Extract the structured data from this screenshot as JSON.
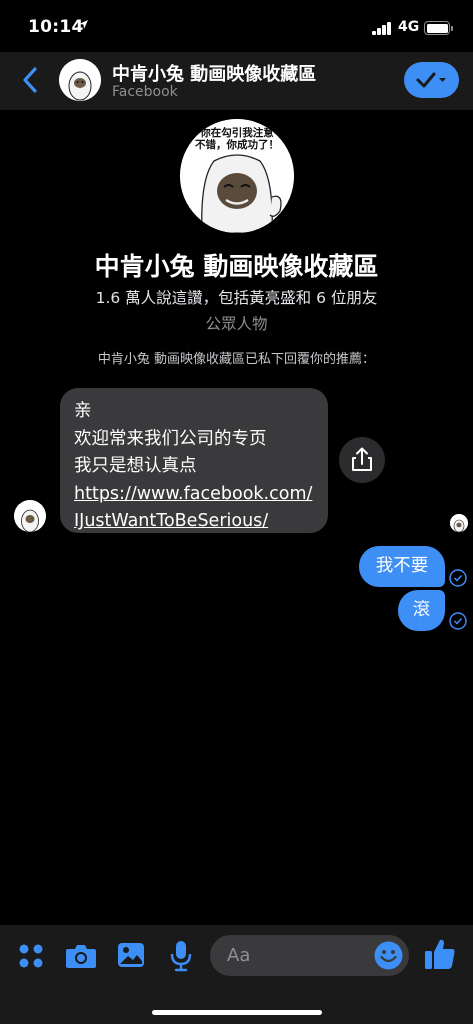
{
  "status_bar": {
    "time": "10:14",
    "network": "4G"
  },
  "header": {
    "title": "中肯小兔 動画映像收藏區",
    "subtitle": "Facebook"
  },
  "profile": {
    "avatar_caption_line1": "你在勾引我注意",
    "avatar_caption_line2": "不错，你成功了！",
    "name": "中肯小兔 動画映像收藏區",
    "likes": "1.6 萬人說這讚，包括黃亮盛和 6 位朋友",
    "category": "公眾人物",
    "reply_note": "中肯小兔 動画映像收藏區已私下回覆你的推薦："
  },
  "messages": {
    "incoming": {
      "line1": "亲",
      "line2": "欢迎常来我们公司的专页",
      "line3": "我只是想认真点",
      "link_line1": "https://www.facebook.com/",
      "link_line2": "IJustWantToBeSerious/"
    },
    "outgoing": [
      "我不要",
      "滾"
    ]
  },
  "composer": {
    "placeholder": "Aa"
  },
  "colors": {
    "accent": "#3d8ef5",
    "incoming_bubble": "#3a3a3c",
    "bar_bg": "#1a1a1a"
  },
  "icons": [
    "location-arrow-icon",
    "back-chevron-icon",
    "check-icon",
    "share-icon",
    "more-dots-icon",
    "camera-icon",
    "gallery-icon",
    "microphone-icon",
    "emoji-icon",
    "thumbs-up-icon"
  ]
}
